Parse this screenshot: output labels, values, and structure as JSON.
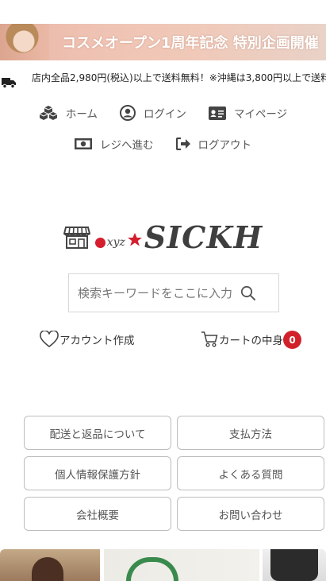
{
  "banner": {
    "text": "コスメオープン1周年記念 特別企画開催"
  },
  "shipping": {
    "text": "店内全品2,980円(税込)以上で送料無料！※沖縄は3,800円以上で送料"
  },
  "nav": {
    "home": "ホーム",
    "login": "ログイン",
    "mypage": "マイページ",
    "checkout": "レジへ進む",
    "logout": "ログアウト"
  },
  "logo": {
    "xyz": "xyz",
    "name": "SICKH"
  },
  "search": {
    "placeholder": "検索キーワードをここに入力"
  },
  "account": {
    "create_label": "アカウント作成",
    "cart_label": "カートの中身",
    "cart_count": "0"
  },
  "links": [
    "配送と返品について",
    "支払方法",
    "個人情報保護方針",
    "よくある質問",
    "会社概要",
    "お問い合わせ"
  ],
  "colors": {
    "accent_red": "#d1222c",
    "text": "#555555",
    "border": "#bdbdbd"
  }
}
